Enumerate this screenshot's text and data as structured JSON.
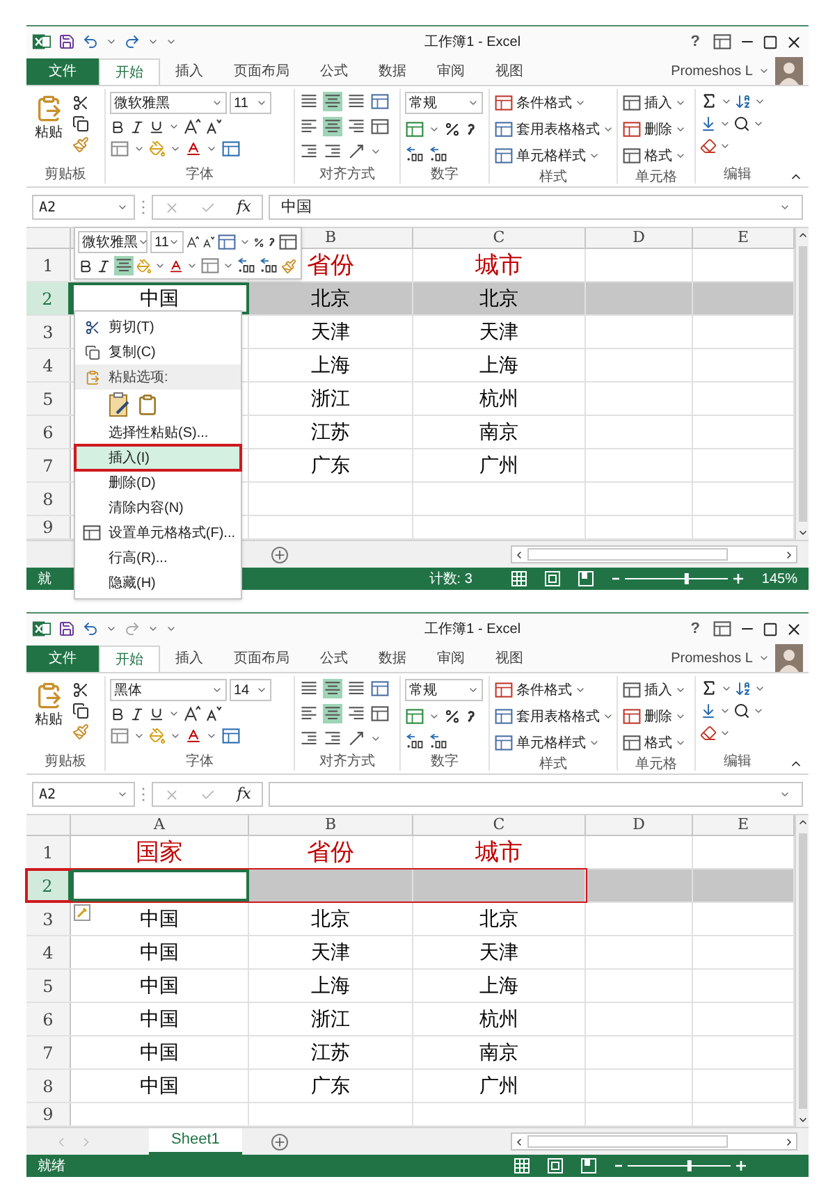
{
  "windows": [
    {
      "title": "工作簿1 - Excel",
      "help": "?",
      "file_tab": "文件",
      "tabs": [
        {
          "label": "开始",
          "selected": true
        },
        {
          "label": "插入",
          "selected": false
        },
        {
          "label": "页面布局",
          "selected": false
        },
        {
          "label": "公式",
          "selected": false
        },
        {
          "label": "数据",
          "selected": false
        },
        {
          "label": "审阅",
          "selected": false
        },
        {
          "label": "视图",
          "selected": false
        }
      ],
      "user": "Promeshos L",
      "ribbon": {
        "paste": "粘贴",
        "font_name": "微软雅黑",
        "font_size": "11",
        "number_format": "常规",
        "styles": [
          "条件格式",
          "套用表格格式",
          "单元格样式"
        ],
        "cells": [
          "插入",
          "删除",
          "格式"
        ],
        "groups": [
          "剪贴板",
          "字体",
          "对齐方式",
          "数字",
          "样式",
          "单元格",
          "编辑"
        ]
      },
      "name_box": "A2",
      "fx": "fx",
      "formula": "中国",
      "columns": [
        "B",
        "C",
        "D",
        "E"
      ],
      "rows": [
        {
          "header": "1",
          "kind": "heading",
          "selected": false,
          "outlined": false,
          "cells": {
            "B": "省份",
            "C": "城市"
          }
        },
        {
          "header": "2",
          "kind": "data",
          "selected": true,
          "outlined": false,
          "cells": {
            "A": "中国",
            "B": "北京",
            "C": "北京"
          }
        },
        {
          "header": "3",
          "kind": "data",
          "selected": false,
          "outlined": false,
          "cells": {
            "B": "天津",
            "C": "天津"
          }
        },
        {
          "header": "4",
          "kind": "data",
          "selected": false,
          "outlined": false,
          "cells": {
            "B": "上海",
            "C": "上海"
          }
        },
        {
          "header": "5",
          "kind": "data",
          "selected": false,
          "outlined": false,
          "cells": {
            "B": "浙江",
            "C": "杭州"
          }
        },
        {
          "header": "6",
          "kind": "data",
          "selected": false,
          "outlined": false,
          "cells": {
            "B": "江苏",
            "C": "南京"
          }
        },
        {
          "header": "7",
          "kind": "data",
          "selected": false,
          "outlined": false,
          "cells": {
            "B": "广东",
            "C": "广州"
          }
        },
        {
          "header": "8",
          "kind": "data",
          "selected": false,
          "outlined": false,
          "cells": {}
        },
        {
          "header": "9",
          "kind": "data",
          "selected": false,
          "outlined": false,
          "cells": {}
        }
      ],
      "status": {
        "ready": "就",
        "count": "计数: 3",
        "zoom_slider": {
          "level": 0.6
        },
        "zoom": "145%"
      },
      "mini_toolbar": {
        "font_name": "微软雅黑",
        "font_size": "11"
      },
      "context_menu": [
        {
          "kind": "item",
          "label": "剪切(T)",
          "highlighted": false
        },
        {
          "kind": "item",
          "label": "复制(C)",
          "highlighted": false
        },
        {
          "kind": "header",
          "label": "粘贴选项:"
        },
        {
          "kind": "paste_icons"
        },
        {
          "kind": "item",
          "label": "选择性粘贴(S)...",
          "highlighted": false
        },
        {
          "kind": "item",
          "label": "插入(I)",
          "highlighted": true
        },
        {
          "kind": "item",
          "label": "删除(D)",
          "highlighted": false
        },
        {
          "kind": "item",
          "label": "清除内容(N)",
          "highlighted": false
        },
        {
          "kind": "item",
          "label": "设置单元格格式(F)...",
          "highlighted": false
        },
        {
          "kind": "item",
          "label": "行高(R)...",
          "highlighted": false
        },
        {
          "kind": "item",
          "label": "隐藏(H)",
          "highlighted": false
        }
      ]
    },
    {
      "title": "工作簿1 - Excel",
      "help": "?",
      "file_tab": "文件",
      "tabs": [
        {
          "label": "开始",
          "selected": true
        },
        {
          "label": "插入",
          "selected": false
        },
        {
          "label": "页面布局",
          "selected": false
        },
        {
          "label": "公式",
          "selected": false
        },
        {
          "label": "数据",
          "selected": false
        },
        {
          "label": "审阅",
          "selected": false
        },
        {
          "label": "视图",
          "selected": false
        }
      ],
      "user": "Promeshos L",
      "ribbon": {
        "paste": "粘贴",
        "font_name": "黑体",
        "font_size": "14",
        "number_format": "常规",
        "styles": [
          "条件格式",
          "套用表格格式",
          "单元格样式"
        ],
        "cells": [
          "插入",
          "删除",
          "格式"
        ],
        "groups": [
          "剪贴板",
          "字体",
          "对齐方式",
          "数字",
          "样式",
          "单元格",
          "编辑"
        ]
      },
      "name_box": "A2",
      "fx": "fx",
      "columns": [
        "A",
        "B",
        "C",
        "D",
        "E"
      ],
      "rows": [
        {
          "header": "1",
          "kind": "heading",
          "selected": false,
          "outlined": false,
          "options_tag": false,
          "cells": {
            "A": "国家",
            "B": "省份",
            "C": "城市"
          }
        },
        {
          "header": "2",
          "kind": "data",
          "selected": true,
          "outlined": true,
          "options_tag": false,
          "cells": {}
        },
        {
          "header": "3",
          "kind": "data",
          "selected": false,
          "outlined": false,
          "options_tag": true,
          "cells": {
            "A": "中国",
            "B": "北京",
            "C": "北京"
          }
        },
        {
          "header": "4",
          "kind": "data",
          "selected": false,
          "outlined": false,
          "options_tag": false,
          "cells": {
            "A": "中国",
            "B": "天津",
            "C": "天津"
          }
        },
        {
          "header": "5",
          "kind": "data",
          "selected": false,
          "outlined": false,
          "options_tag": false,
          "cells": {
            "A": "中国",
            "B": "上海",
            "C": "上海"
          }
        },
        {
          "header": "6",
          "kind": "data",
          "selected": false,
          "outlined": false,
          "options_tag": false,
          "cells": {
            "A": "中国",
            "B": "浙江",
            "C": "杭州"
          }
        },
        {
          "header": "7",
          "kind": "data",
          "selected": false,
          "outlined": false,
          "options_tag": false,
          "cells": {
            "A": "中国",
            "B": "江苏",
            "C": "南京"
          }
        },
        {
          "header": "8",
          "kind": "data",
          "selected": false,
          "outlined": false,
          "options_tag": false,
          "cells": {
            "A": "中国",
            "B": "广东",
            "C": "广州"
          }
        },
        {
          "header": "9",
          "kind": "data",
          "selected": false,
          "outlined": false,
          "options_tag": false,
          "cells": {}
        }
      ],
      "sheet_tabs": [
        {
          "label": "Sheet1",
          "selected": true
        }
      ],
      "status": {
        "ready": "就绪",
        "zoom_slider": {
          "level": 0.6
        }
      }
    }
  ]
}
